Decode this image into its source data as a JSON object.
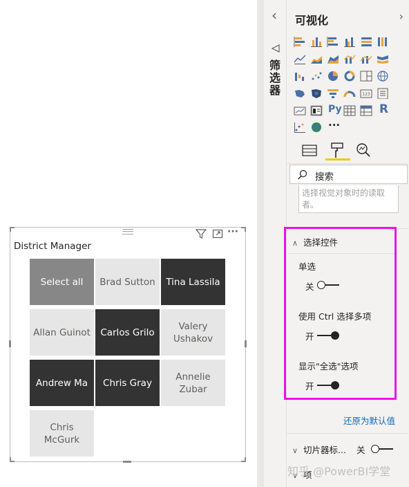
{
  "slicer": {
    "title": "District Manager",
    "items": [
      {
        "label": "Select all",
        "state": "all"
      },
      {
        "label": "Brad Sutton",
        "state": "unselected"
      },
      {
        "label": "Tina Lassila",
        "state": "selected"
      },
      {
        "label": "Allan Guinot",
        "state": "unselected"
      },
      {
        "label": "Carlos Grilo",
        "state": "selected"
      },
      {
        "label": "Valery Ushakov",
        "state": "unselected"
      },
      {
        "label": "Andrew Ma",
        "state": "selected"
      },
      {
        "label": "Chris Gray",
        "state": "selected"
      },
      {
        "label": "Annelie Zubar",
        "state": "unselected"
      },
      {
        "label": "Chris McGurk",
        "state": "unselected"
      }
    ],
    "icons": [
      "filter-icon",
      "focus-mode-icon",
      "more-options-icon"
    ],
    "more_glyph": "···"
  },
  "filters_strip": {
    "label": "筛选器",
    "collapse_glyph": "‹"
  },
  "pane": {
    "title": "可视化",
    "expand_glyph": "›",
    "py_label": "Py",
    "r_label": "R",
    "more_glyph": "···",
    "search_placeholder": "搜索",
    "alt_text_placeholder": "选择视觉对象时的读取者。",
    "selection_section": {
      "title": "选择控件",
      "single_select": {
        "label": "单选",
        "toggle_text": "关",
        "value": false
      },
      "ctrl_multi": {
        "label": "使用 Ctrl 选择多项",
        "toggle_text": "开",
        "value": true
      },
      "show_select_all": {
        "label": "显示\"全选\"选项",
        "toggle_text": "开",
        "value": true
      }
    },
    "reset_label": "还原为默认值",
    "next_section": {
      "title": "切片器标...",
      "toggle_text": "关",
      "value": false
    },
    "partial_section": "项"
  },
  "watermark": "知乎 @PowerBI学堂",
  "colors": {
    "highlight": "#e815e8",
    "selected_tile": "#333333",
    "unselected_tile": "#e6e6e6",
    "select_all_tile": "#878787",
    "accent": "#f2c811",
    "link": "#0f6cbd"
  }
}
